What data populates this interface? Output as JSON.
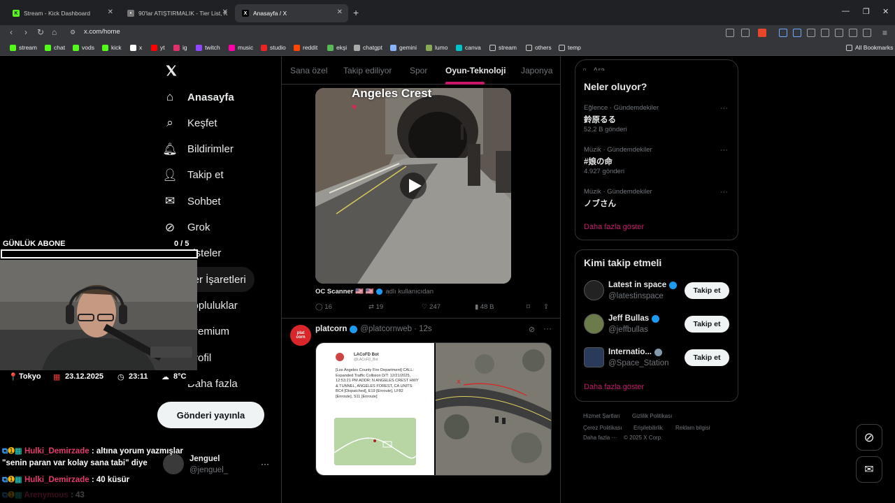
{
  "browser": {
    "tabs": [
      {
        "label": "Stream - Kick Dashboard"
      },
      {
        "label": "90'lar ATIŞTIRMALIK - Tier List, Kör Se"
      },
      {
        "label": "Anasayfa / X"
      }
    ],
    "url": "x.com/home",
    "bookmarks": [
      "stream",
      "chat",
      "vods",
      "kick",
      "x",
      "yt",
      "ig",
      "twitch",
      "music",
      "studio",
      "reddit",
      "ekşi",
      "chatgpt",
      "gemini",
      "lumo",
      "canva",
      "stream",
      "others",
      "temp"
    ],
    "all_bookmarks": "All Bookmarks"
  },
  "sidebar": {
    "items": [
      {
        "label": "Anasayfa",
        "icon": "home-icon"
      },
      {
        "label": "Keşfet",
        "icon": "search-icon"
      },
      {
        "label": "Bildirimler",
        "icon": "bell-icon"
      },
      {
        "label": "Takip et",
        "icon": "follow-icon"
      },
      {
        "label": "Sohbet",
        "icon": "mail-icon"
      },
      {
        "label": "Grok",
        "icon": "grok-icon"
      },
      {
        "label": "Listeler",
        "icon": "list-icon"
      },
      {
        "label": "Yer İşaretleri",
        "icon": "bookmark-icon"
      },
      {
        "label": "Topluluklar",
        "icon": "communities-icon"
      },
      {
        "label": "Premium",
        "icon": "premium-icon"
      },
      {
        "label": "Profil",
        "icon": "profile-icon"
      },
      {
        "label": "Daha fazla",
        "icon": "more-icon"
      }
    ],
    "post_button": "Gönderi yayınla",
    "account_name": "Jenguel",
    "account_handle": "@jenguel_"
  },
  "feed": {
    "tabs": [
      "Sana özel",
      "Takip ediliyor",
      "Spor",
      "Oyun-Teknoloji",
      "Japonya"
    ],
    "active_tab": "Oyun-Teknoloji",
    "post1": {
      "video_caption": "Angeles Crest",
      "source_name": "OC Scanner 🇺🇸 🇺🇸",
      "source_via": "adlı kullanıcıdan",
      "replies": "16",
      "reposts": "19",
      "likes": "247",
      "views": "48 B"
    },
    "post2": {
      "name": "platcorn",
      "handle": "@platcornweb",
      "time": "· 12s",
      "doc_title": "LACoFD Bot",
      "doc_handle": "@LACoFD_Bot",
      "doc_text": "[Los Angeles County Fire Department] CALL: Expanded Traffic Collision D/T: 12/21/2025, 12:53:21 PM ADDR: N ANGELES CREST HWY & TUNNEL, ANGELES FOREST, CA UNITS: BC4 [Dispatched], E19 [Enroute], LF82 [Enroute], S11 [Enroute]"
    }
  },
  "right": {
    "search_placeholder": "Ara",
    "trends_title": "Neler oluyor?",
    "trends": [
      {
        "category": "Eğlence · Gündemdekiler",
        "name": "鈴原るる",
        "count": "52,2 B gönderi"
      },
      {
        "category": "Müzik · Gündemdekiler",
        "name": "#娘の命",
        "count": "4.927 gönderi"
      },
      {
        "category": "Müzik · Gündemdekiler",
        "name": "ノブさん",
        "count": ""
      }
    ],
    "show_more": "Daha fazla göster",
    "who_title": "Kimi takip etmeli",
    "who": [
      {
        "name": "Latest in space",
        "handle": "@latestinspace"
      },
      {
        "name": "Jeff Bullas",
        "handle": "@jeffbullas"
      },
      {
        "name": "Internatio...",
        "handle": "@Space_Station"
      }
    ],
    "follow_label": "Takip et",
    "footer": [
      "Hizmet Şartları",
      "Gizlilik Politikası",
      "Çerez Politikası",
      "Erişilebilirlik",
      "Reklam bilgisi",
      "Daha fazla ···",
      "© 2025 X Corp."
    ]
  },
  "overlay": {
    "sub_label": "GÜNLÜK ABONE",
    "sub_count": "0 / 5",
    "sub_progress": 0,
    "location": "Tokyo",
    "date": "23.12.2025",
    "time": "23:11",
    "temp": "8°C",
    "chat": [
      {
        "user": "Hulki_Demirzade",
        "msg": ": altına yorum yazmışlar"
      },
      {
        "user": "",
        "msg": "\"senin paran var kolay sana tabi\" diye"
      },
      {
        "user": "Hulki_Demirzade",
        "msg": ": 40 küsür"
      },
      {
        "user": "Arenymous",
        "msg": ": 43"
      }
    ]
  }
}
